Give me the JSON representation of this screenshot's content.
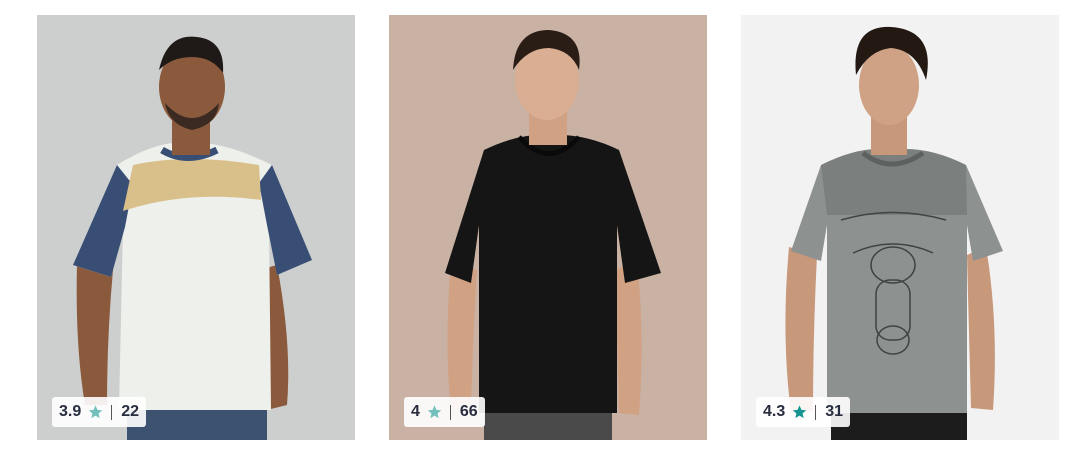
{
  "products": [
    {
      "rating": "3.9",
      "count": "22",
      "star_color": "#72bfbc"
    },
    {
      "rating": "4",
      "count": "66",
      "star_color": "#72bfbc"
    },
    {
      "rating": "4.3",
      "count": "31",
      "star_color": "#14958f"
    }
  ]
}
